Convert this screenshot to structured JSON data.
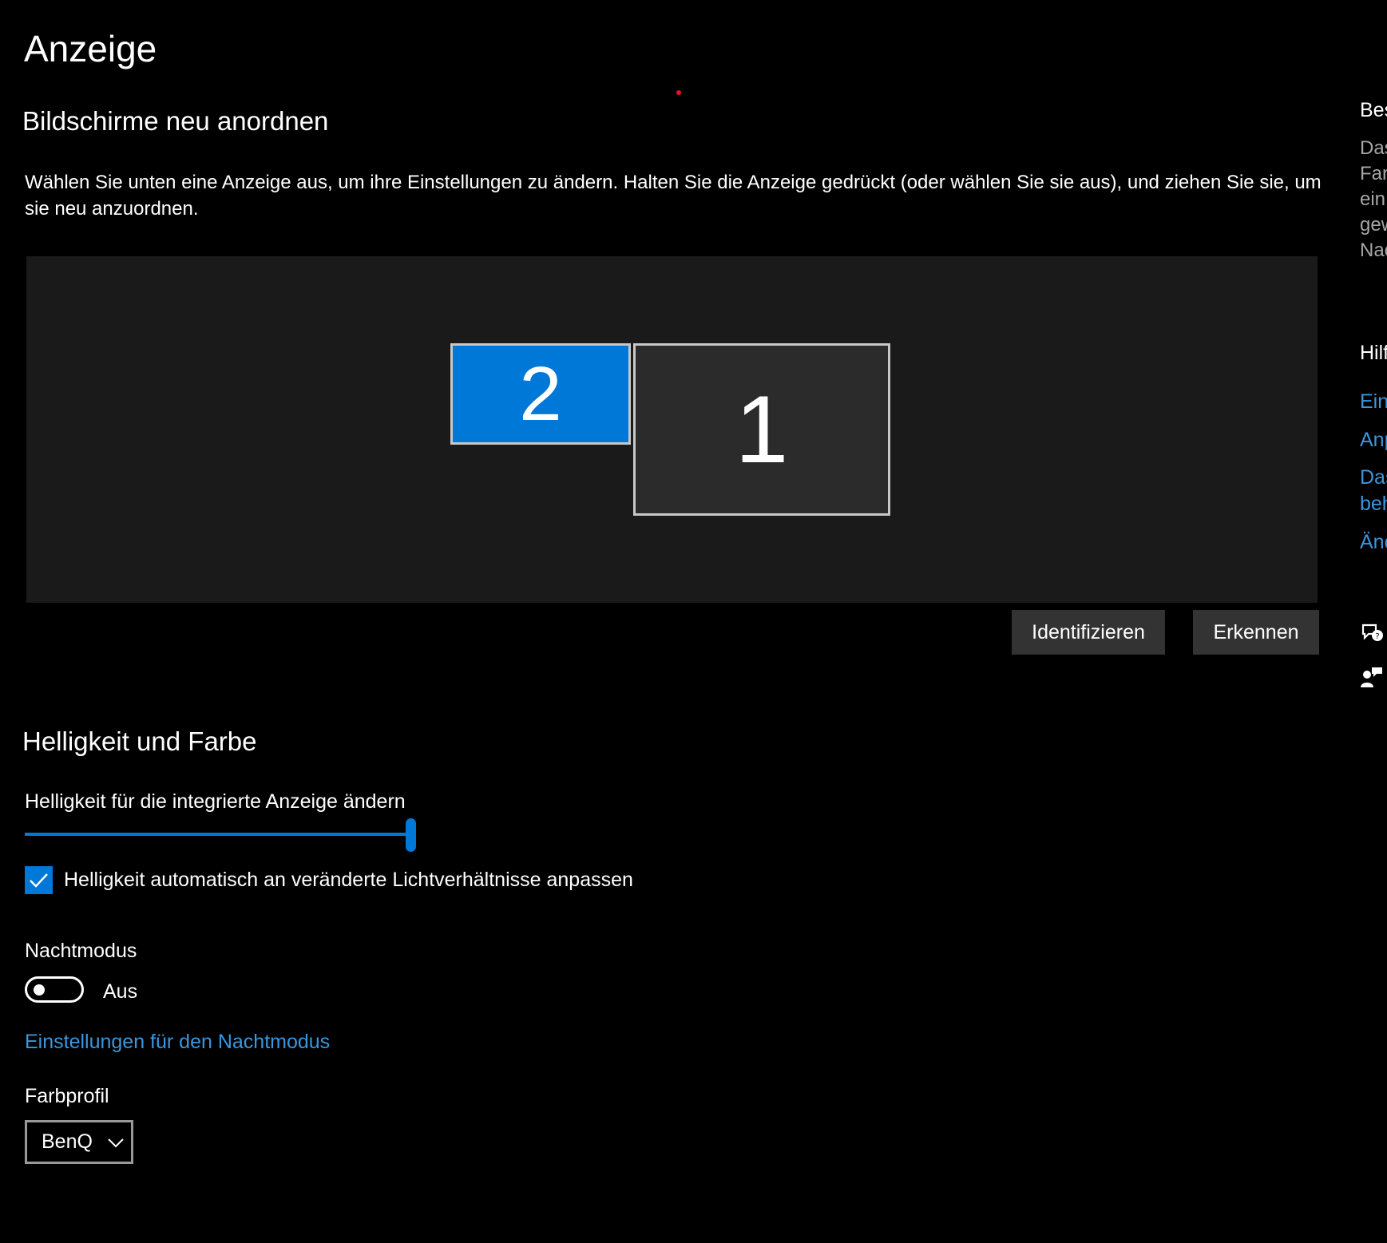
{
  "page_title": "Anzeige",
  "arrange": {
    "title": "Bildschirme neu anordnen",
    "description": "Wählen Sie unten eine Anzeige aus, um ihre Einstellungen zu ändern. Halten Sie die Anzeige gedrückt (oder wählen Sie sie aus), und ziehen Sie sie, um sie neu anzuordnen.",
    "monitors": [
      {
        "label": "2",
        "selected": true
      },
      {
        "label": "1",
        "selected": false
      }
    ],
    "identify_button": "Identifizieren",
    "detect_button": "Erkennen"
  },
  "brightness": {
    "title": "Helligkeit und Farbe",
    "slider_label": "Helligkeit für die integrierte Anzeige ändern",
    "slider_value_percent": 100,
    "auto_checkbox_label": "Helligkeit automatisch an veränderte Lichtverhältnisse anpassen",
    "auto_checked": true,
    "night_mode_label": "Nachtmodus",
    "night_mode_state": "Aus",
    "night_mode_on": false,
    "night_mode_link": "Einstellungen für den Nachtmodus",
    "color_profile_label": "Farbprofil",
    "color_profile_value": "BenQ"
  },
  "right_panel": {
    "heading1": "Bes",
    "text_lines": [
      "Das",
      "Far",
      "ein",
      "gew",
      "Nac"
    ],
    "heading2": "Hilf",
    "links": [
      "Ein",
      "Anp",
      "Das",
      "beh",
      "Änd"
    ],
    "icons": [
      "feedback-icon",
      "help-person-icon"
    ]
  },
  "colors": {
    "accent": "#0078d7",
    "link": "#3a96dd",
    "background": "#000000",
    "panel": "#1a1a1a",
    "button": "#333333"
  }
}
